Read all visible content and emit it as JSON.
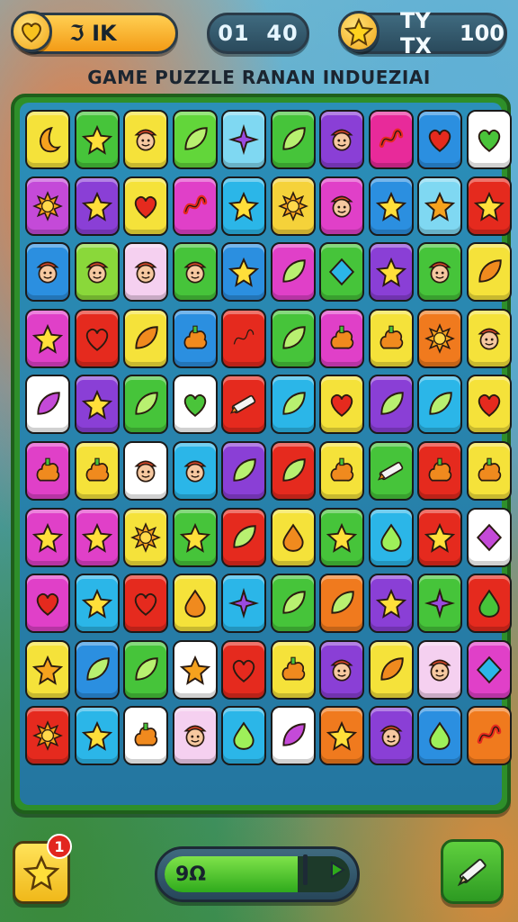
{
  "hud": {
    "left_value": "ℑ IK",
    "timer": "01  40",
    "right_label": "TY TX",
    "right_value": "100"
  },
  "title": "GAME PUZZLE RANAN INDUEZIAI",
  "board": {
    "rows": [
      [
        [
          "#f5e23a",
          "moon"
        ],
        [
          "#46c43a",
          "star"
        ],
        [
          "#f5e23a",
          "face"
        ],
        [
          "#62d63a",
          "leaf"
        ],
        [
          "#7fd8f2",
          "star4"
        ],
        [
          "#46c43a",
          "leaf"
        ],
        [
          "#8a3fd6",
          "face"
        ],
        [
          "#e82a9a",
          "squiggle"
        ],
        [
          "#2b8fe0",
          "heart"
        ],
        [
          "#ffffff",
          "heart"
        ]
      ],
      [
        [
          "#c44ad8",
          "sun"
        ],
        [
          "#8a3fd6",
          "star"
        ],
        [
          "#f5e23a",
          "heart"
        ],
        [
          "#e040c8",
          "squiggle"
        ],
        [
          "#2bb6e8",
          "star"
        ],
        [
          "#f5d23a",
          "sun"
        ],
        [
          "#e040c8",
          "face"
        ],
        [
          "#2b8fe0",
          "star"
        ],
        [
          "#7fd8f2",
          "star"
        ],
        [
          "#e52a1e",
          "star"
        ]
      ],
      [
        [
          "#2b8fe0",
          "face"
        ],
        [
          "#8ad83a",
          "face"
        ],
        [
          "#f5d0f0",
          "face"
        ],
        [
          "#46c43a",
          "face"
        ],
        [
          "#2b8fe0",
          "star"
        ],
        [
          "#e040c8",
          "leaf"
        ],
        [
          "#46c43a",
          "diamond"
        ],
        [
          "#8a3fd6",
          "star"
        ],
        [
          "#46c43a",
          "face"
        ],
        [
          "#f5e23a",
          "leaf"
        ]
      ],
      [
        [
          "#e040c8",
          "star"
        ],
        [
          "#e52a1e",
          "heart"
        ],
        [
          "#f5e23a",
          "leaf"
        ],
        [
          "#2b8fe0",
          "bush"
        ],
        [
          "#e52a1e",
          "squiggle"
        ],
        [
          "#46c43a",
          "leaf"
        ],
        [
          "#e040c8",
          "bush"
        ],
        [
          "#f5e23a",
          "bush"
        ],
        [
          "#f07a1e",
          "sun"
        ],
        [
          "#f5e23a",
          "face"
        ]
      ],
      [
        [
          "#ffffff",
          "leaf"
        ],
        [
          "#8a3fd6",
          "star"
        ],
        [
          "#46c43a",
          "leaf"
        ],
        [
          "#ffffff",
          "heart"
        ],
        [
          "#e52a1e",
          "pencil"
        ],
        [
          "#2bb6e8",
          "leaf"
        ],
        [
          "#f5e23a",
          "heart"
        ],
        [
          "#8a3fd6",
          "leaf"
        ],
        [
          "#2bb6e8",
          "leaf"
        ],
        [
          "#f5e23a",
          "heart"
        ]
      ],
      [
        [
          "#e040c8",
          "bush"
        ],
        [
          "#f5e23a",
          "bush"
        ],
        [
          "#ffffff",
          "face"
        ],
        [
          "#2bb6e8",
          "face"
        ],
        [
          "#8a3fd6",
          "leaf"
        ],
        [
          "#e52a1e",
          "leaf"
        ],
        [
          "#f5e23a",
          "bush"
        ],
        [
          "#46c43a",
          "pencil"
        ],
        [
          "#e52a1e",
          "bush"
        ],
        [
          "#f5e23a",
          "bush"
        ]
      ],
      [
        [
          "#e040c8",
          "star"
        ],
        [
          "#e040c8",
          "star"
        ],
        [
          "#f5e23a",
          "sun"
        ],
        [
          "#46c43a",
          "star"
        ],
        [
          "#e52a1e",
          "leaf"
        ],
        [
          "#f5e23a",
          "drop"
        ],
        [
          "#46c43a",
          "star"
        ],
        [
          "#2bb6e8",
          "drop"
        ],
        [
          "#e52a1e",
          "star"
        ],
        [
          "#ffffff",
          "diamond"
        ]
      ],
      [
        [
          "#e040c8",
          "heart"
        ],
        [
          "#2bb6e8",
          "star"
        ],
        [
          "#e52a1e",
          "heart"
        ],
        [
          "#f5e23a",
          "drop"
        ],
        [
          "#2bb6e8",
          "star4"
        ],
        [
          "#46c43a",
          "leaf"
        ],
        [
          "#f07a1e",
          "leaf"
        ],
        [
          "#8a3fd6",
          "star"
        ],
        [
          "#46c43a",
          "star4"
        ],
        [
          "#e52a1e",
          "drop"
        ]
      ],
      [
        [
          "#f5e23a",
          "star"
        ],
        [
          "#2b8fe0",
          "leaf"
        ],
        [
          "#46c43a",
          "leaf"
        ],
        [
          "#ffffff",
          "star"
        ],
        [
          "#e52a1e",
          "heart"
        ],
        [
          "#f5e23a",
          "bush"
        ],
        [
          "#8a3fd6",
          "face"
        ],
        [
          "#f5e23a",
          "leaf"
        ],
        [
          "#f5d0f0",
          "face"
        ],
        [
          "#e040c8",
          "diamond"
        ]
      ],
      [
        [
          "#e52a1e",
          "sun"
        ],
        [
          "#2bb6e8",
          "star"
        ],
        [
          "#ffffff",
          "bush"
        ],
        [
          "#f5d0f0",
          "face"
        ],
        [
          "#2bb6e8",
          "drop"
        ],
        [
          "#ffffff",
          "leaf"
        ],
        [
          "#f07a1e",
          "star"
        ],
        [
          "#8a3fd6",
          "face"
        ],
        [
          "#2b8fe0",
          "drop"
        ],
        [
          "#f07a1e",
          "squiggle"
        ]
      ]
    ]
  },
  "bottom": {
    "notification_count": "1",
    "progress_label": "9Ω",
    "progress_fraction": 0.72
  },
  "colors": {
    "gold": "#f3a516",
    "board_green": "#2e8f2a",
    "hud_dark": "#2a4a5c"
  },
  "icons": {
    "hud_left": "heart-badge-icon",
    "hud_right": "star-badge-icon",
    "bottom_left": "star-icon",
    "bottom_right": "pencil-icon",
    "progress_end": "play-icon"
  }
}
